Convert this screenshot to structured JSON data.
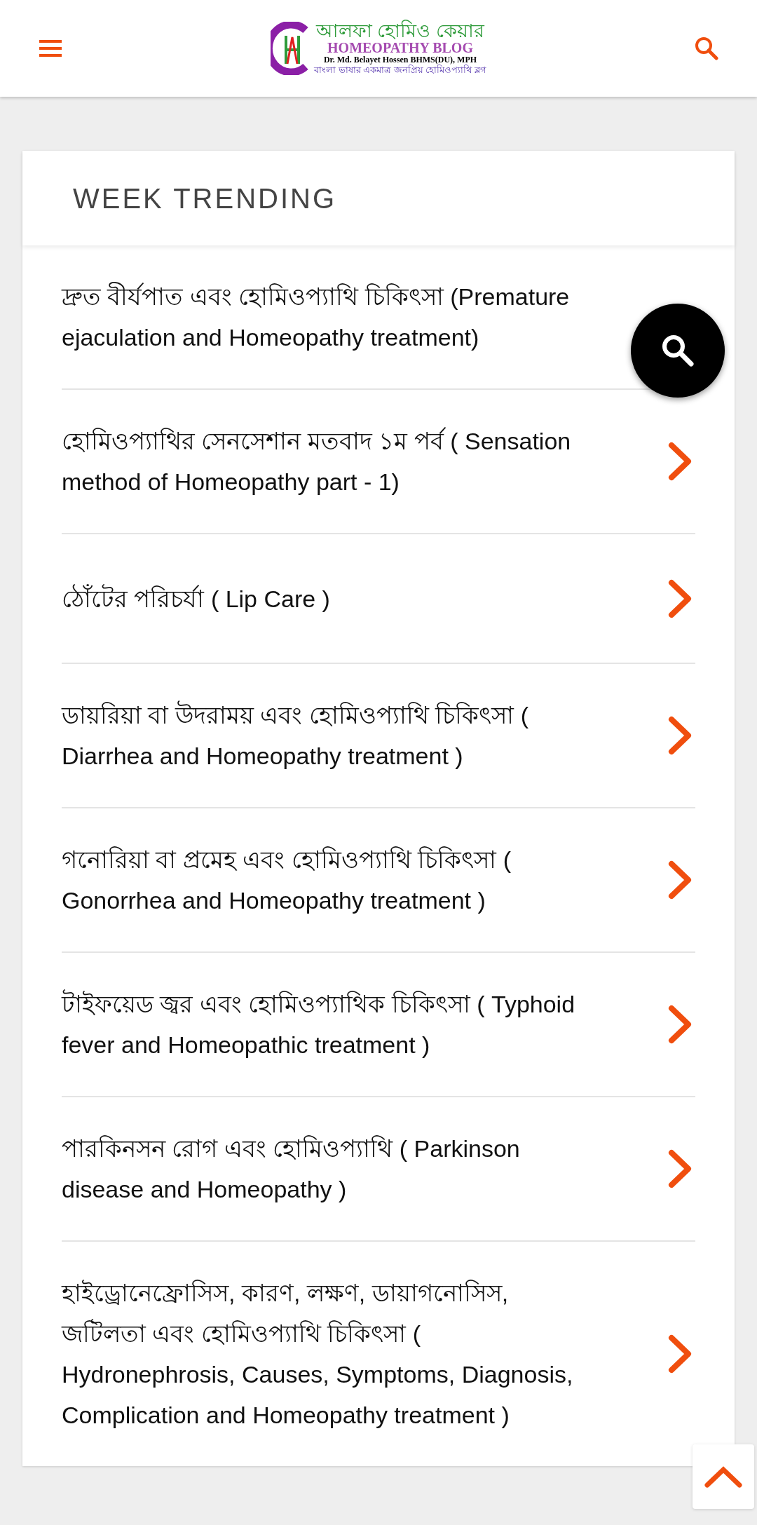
{
  "header": {
    "logo": {
      "title": "আলফা হোমিও কেয়ার",
      "subtitle": "HOMEOPATHY BLOG",
      "author": "Dr. Md. Belayet Hossen BHMS(DU), MPH",
      "tagline": "বাংলা ভাষার একমাত্র জনপ্রিয় হোমিওপ্যাথি ব্লগ"
    }
  },
  "section": {
    "title": "WEEK TRENDING",
    "items": [
      {
        "title": "দ্রুত বীর্যপাত এবং হোমিওপ্যাথি চিকিৎসা (Premature ejaculation and Homeopathy treatment)",
        "arrow": false
      },
      {
        "title": "হোমিওপ্যাথির সেনসেশান মতবাদ ১ম পর্ব ( Sensation method of Homeopathy part - 1)",
        "arrow": true
      },
      {
        "title": "ঠোঁটের পরিচর্যা ( Lip Care )",
        "arrow": true
      },
      {
        "title": "ডায়রিয়া বা উদরাময় এবং হোমিওপ্যাথি চিকিৎসা ( Diarrhea and Homeopathy treatment )",
        "arrow": true
      },
      {
        "title": "গনোরিয়া বা প্রমেহ এবং হোমিওপ্যাথি চিকিৎসা ( Gonorrhea and Homeopathy treatment )",
        "arrow": true
      },
      {
        "title": "টাইফয়েড জ্বর এবং হোমিওপ্যাথিক চিকিৎসা ( Typhoid fever and Homeopathic treatment )",
        "arrow": true
      },
      {
        "title": "পারকিনসন রোগ এবং হোমিওপ্যাথি ( Parkinson disease and Homeopathy )",
        "arrow": true
      },
      {
        "title": "হাইড্রোনেফ্রোসিস, কারণ, লক্ষণ, ডায়াগনোসিস, জটিলতা এবং হোমিওপ্যাথি চিকিৎসা ( Hydronephrosis, Causes, Symptoms, Diagnosis, Complication and Homeopathy treatment )",
        "arrow": true
      }
    ]
  }
}
